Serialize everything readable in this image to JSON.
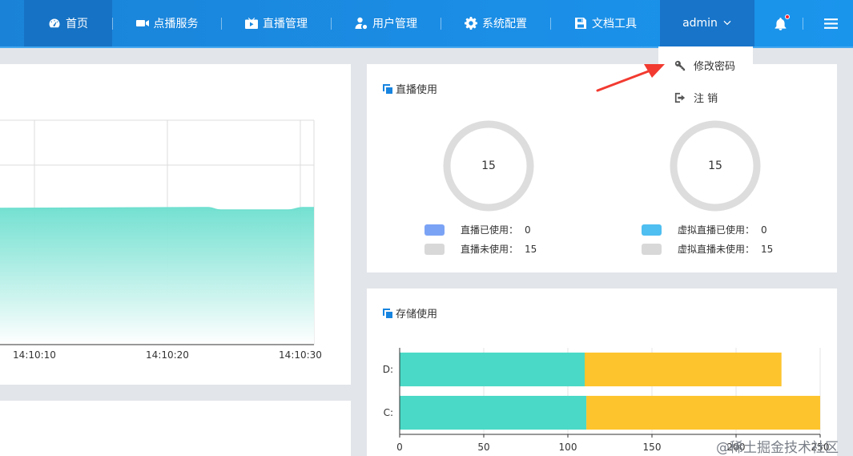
{
  "nav": {
    "home": "首页",
    "vod": "点播服务",
    "live": "直播管理",
    "users": "用户管理",
    "system": "系统配置",
    "docs": "文档工具",
    "user": "admin"
  },
  "menu": {
    "change_password": "修改密码",
    "logout": "注 销"
  },
  "line_chart": {
    "x_ticks": [
      "14:10:10",
      "14:10:20",
      "14:10:30"
    ],
    "area_color": "#6ddfcf"
  },
  "live_usage": {
    "title": "直播使用",
    "rings": [
      {
        "total": "15",
        "legend": [
          {
            "label": "直播已使用：",
            "value": "0",
            "color": "#7ba3f5"
          },
          {
            "label": "直播未使用：",
            "value": "15",
            "color": "#d8d8d8"
          }
        ]
      },
      {
        "total": "15",
        "legend": [
          {
            "label": "虚拟直播已使用：",
            "value": "0",
            "color": "#4fbef0"
          },
          {
            "label": "虚拟直播未使用：",
            "value": "15",
            "color": "#d8d8d8"
          }
        ]
      }
    ]
  },
  "storage": {
    "title": "存储使用"
  },
  "chart_data": {
    "type": "bar",
    "orientation": "horizontal",
    "stacked": true,
    "categories": [
      "D:",
      "C:"
    ],
    "series": [
      {
        "values": [
          110,
          111
        ],
        "color": "#4ad9c6"
      },
      {
        "values": [
          117,
          139
        ],
        "color": "#fec42d"
      }
    ],
    "xlim": [
      0,
      250
    ],
    "x_ticks": [
      0,
      50,
      100,
      150,
      200,
      250
    ],
    "grid": true
  },
  "watermark": "@稀土掘金技术社区"
}
